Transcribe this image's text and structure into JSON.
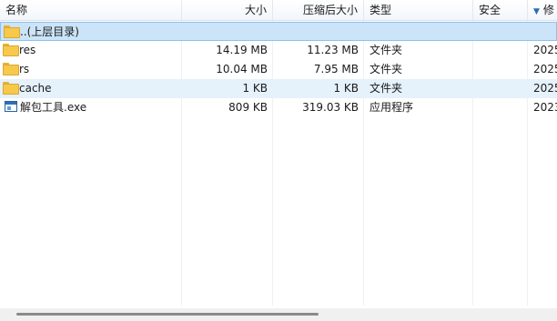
{
  "columns": {
    "name": "名称",
    "size": "大小",
    "packed": "压缩后大小",
    "type": "类型",
    "security": "安全",
    "modified": "修"
  },
  "files": [
    {
      "name": "..(上层目录)",
      "icon": "folder-up-icon",
      "size": "",
      "packed": "",
      "type": "",
      "modified": ""
    },
    {
      "name": "res",
      "icon": "folder-icon",
      "size": "14.19 MB",
      "packed": "11.23 MB",
      "type": "文件夹",
      "modified": "2025"
    },
    {
      "name": "rs",
      "icon": "folder-icon",
      "size": "10.04 MB",
      "packed": "7.95 MB",
      "type": "文件夹",
      "modified": "2025"
    },
    {
      "name": "cache",
      "icon": "folder-icon",
      "size": "1 KB",
      "packed": "1 KB",
      "type": "文件夹",
      "modified": "2025"
    },
    {
      "name": "解包工具.exe",
      "icon": "exe-icon",
      "size": "809 KB",
      "packed": "319.03 KB",
      "type": "应用程序",
      "modified": "2023"
    }
  ],
  "sort_icon": "sort-down-arrow-icon",
  "scroll_position": 0.0
}
